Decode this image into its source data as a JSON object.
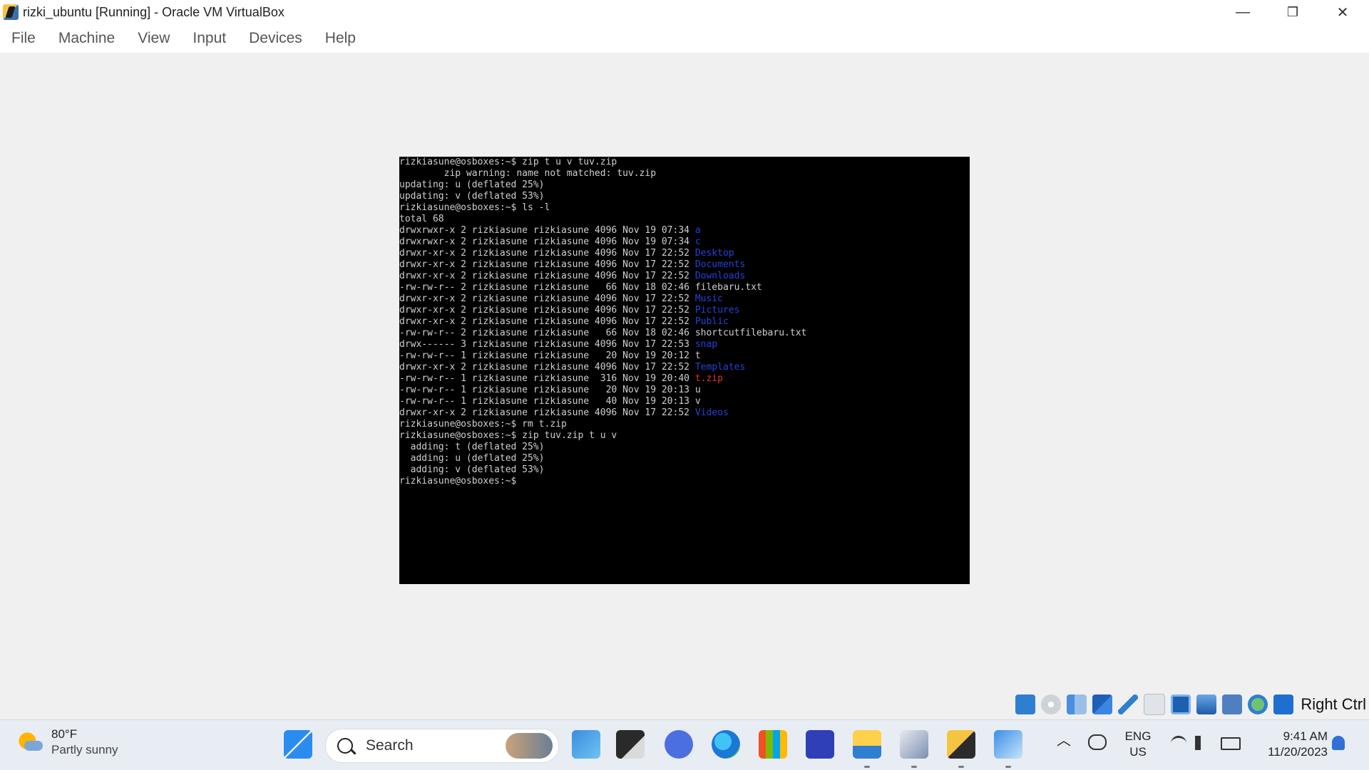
{
  "window": {
    "title": "rizki_ubuntu [Running] - Oracle VM VirtualBox",
    "minimize_glyph": "—",
    "restore_glyph": "❐",
    "close_glyph": "✕"
  },
  "menu": {
    "file": "File",
    "machine": "Machine",
    "view": "View",
    "input": "Input",
    "devices": "Devices",
    "help": "Help"
  },
  "terminal": {
    "lines": [
      {
        "text": "rizkiasune@osboxes:~$ zip t u v tuv.zip",
        "highlight": "",
        "hl_color": ""
      },
      {
        "text": "        zip warning: name not matched: tuv.zip",
        "highlight": "",
        "hl_color": ""
      },
      {
        "text": "updating: u (deflated 25%)",
        "highlight": "",
        "hl_color": ""
      },
      {
        "text": "updating: v (deflated 53%)",
        "highlight": "",
        "hl_color": ""
      },
      {
        "text": "rizkiasune@osboxes:~$ ls -l",
        "highlight": "",
        "hl_color": ""
      },
      {
        "text": "total 68",
        "highlight": "",
        "hl_color": ""
      },
      {
        "text": "drwxrwxr-x 2 rizkiasune rizkiasune 4096 Nov 19 07:34 ",
        "highlight": "a",
        "hl_color": "blue"
      },
      {
        "text": "drwxrwxr-x 2 rizkiasune rizkiasune 4096 Nov 19 07:34 ",
        "highlight": "c",
        "hl_color": "blue"
      },
      {
        "text": "drwxr-xr-x 2 rizkiasune rizkiasune 4096 Nov 17 22:52 ",
        "highlight": "Desktop",
        "hl_color": "blue"
      },
      {
        "text": "drwxr-xr-x 2 rizkiasune rizkiasune 4096 Nov 17 22:52 ",
        "highlight": "Documents",
        "hl_color": "blue"
      },
      {
        "text": "drwxr-xr-x 2 rizkiasune rizkiasune 4096 Nov 17 22:52 ",
        "highlight": "Downloads",
        "hl_color": "blue"
      },
      {
        "text": "-rw-rw-r-- 2 rizkiasune rizkiasune   66 Nov 18 02:46 filebaru.txt",
        "highlight": "",
        "hl_color": ""
      },
      {
        "text": "drwxr-xr-x 2 rizkiasune rizkiasune 4096 Nov 17 22:52 ",
        "highlight": "Music",
        "hl_color": "blue"
      },
      {
        "text": "drwxr-xr-x 2 rizkiasune rizkiasune 4096 Nov 17 22:52 ",
        "highlight": "Pictures",
        "hl_color": "blue"
      },
      {
        "text": "drwxr-xr-x 2 rizkiasune rizkiasune 4096 Nov 17 22:52 ",
        "highlight": "Public",
        "hl_color": "blue"
      },
      {
        "text": "-rw-rw-r-- 2 rizkiasune rizkiasune   66 Nov 18 02:46 shortcutfilebaru.txt",
        "highlight": "",
        "hl_color": ""
      },
      {
        "text": "drwx------ 3 rizkiasune rizkiasune 4096 Nov 17 22:53 ",
        "highlight": "snap",
        "hl_color": "blue"
      },
      {
        "text": "-rw-rw-r-- 1 rizkiasune rizkiasune   20 Nov 19 20:12 t",
        "highlight": "",
        "hl_color": ""
      },
      {
        "text": "drwxr-xr-x 2 rizkiasune rizkiasune 4096 Nov 17 22:52 ",
        "highlight": "Templates",
        "hl_color": "blue"
      },
      {
        "text": "-rw-rw-r-- 1 rizkiasune rizkiasune  316 Nov 19 20:40 ",
        "highlight": "t.zip",
        "hl_color": "red"
      },
      {
        "text": "-rw-rw-r-- 1 rizkiasune rizkiasune   20 Nov 19 20:13 u",
        "highlight": "",
        "hl_color": ""
      },
      {
        "text": "-rw-rw-r-- 1 rizkiasune rizkiasune   40 Nov 19 20:13 v",
        "highlight": "",
        "hl_color": ""
      },
      {
        "text": "drwxr-xr-x 2 rizkiasune rizkiasune 4096 Nov 17 22:52 ",
        "highlight": "Videos",
        "hl_color": "blue"
      },
      {
        "text": "rizkiasune@osboxes:~$ rm t.zip",
        "highlight": "",
        "hl_color": ""
      },
      {
        "text": "rizkiasune@osboxes:~$ zip tuv.zip t u v",
        "highlight": "",
        "hl_color": ""
      },
      {
        "text": "  adding: t (deflated 25%)",
        "highlight": "",
        "hl_color": ""
      },
      {
        "text": "  adding: u (deflated 25%)",
        "highlight": "",
        "hl_color": ""
      },
      {
        "text": "  adding: v (deflated 53%)",
        "highlight": "",
        "hl_color": ""
      },
      {
        "text": "rizkiasune@osboxes:~$",
        "highlight": "",
        "hl_color": ""
      }
    ]
  },
  "statusbar": {
    "icons": [
      "hard-disk-icon",
      "optical-drive-icon",
      "audio-icon",
      "network-icon",
      "usb-icon",
      "shared-folders-icon",
      "display-icon",
      "video-capture-icon",
      "vrdp-icon",
      "mouse-integration-icon",
      "keyboard-capture-icon"
    ],
    "host_key": "Right Ctrl"
  },
  "taskbar": {
    "weather_temp": "80°F",
    "weather_condition": "Partly sunny",
    "search_label": "Search",
    "tray_lang_line1": "ENG",
    "tray_lang_line2": "US",
    "clock_time": "9:41 AM",
    "clock_date": "11/20/2023",
    "apps": [
      "start-icon",
      "copilot-pre-icon",
      "task-view-icon",
      "chat-icon",
      "edge-icon",
      "store-icon",
      "visual-studio-icon",
      "file-explorer-icon",
      "virtualbox-icon",
      "virtualbox-64-icon",
      "paint-icon"
    ]
  },
  "colors": {
    "terminal_bg": "#000000",
    "terminal_fg": "#cfcfcf",
    "dir_blue": "#2442d6",
    "archive_red": "#e8322a",
    "taskbar_bg": "#e8ecf3"
  }
}
